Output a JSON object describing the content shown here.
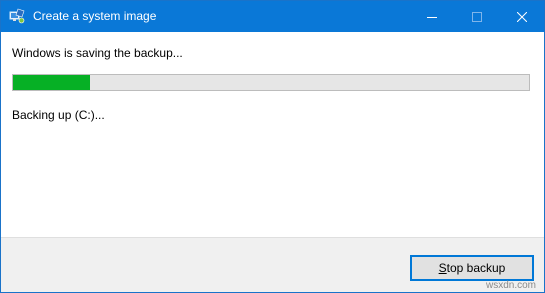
{
  "window": {
    "title": "Create a system image"
  },
  "titlebar_controls": [
    "minimize-icon",
    "maximize-icon",
    "close-icon"
  ],
  "status": {
    "message": "Windows is saving the backup...",
    "detail": "Backing up (C:)...",
    "progress_percent": 15
  },
  "footer": {
    "stop_button": {
      "mnemonic": "S",
      "rest": "top backup"
    }
  },
  "watermark": "wsxdn.com",
  "colors": {
    "titlebar": "#0a78d7",
    "progress_fill": "#06b025",
    "progress_track": "#e6e6e6",
    "footer_bg": "#f0f0f0",
    "focus_border": "#0078d7"
  }
}
